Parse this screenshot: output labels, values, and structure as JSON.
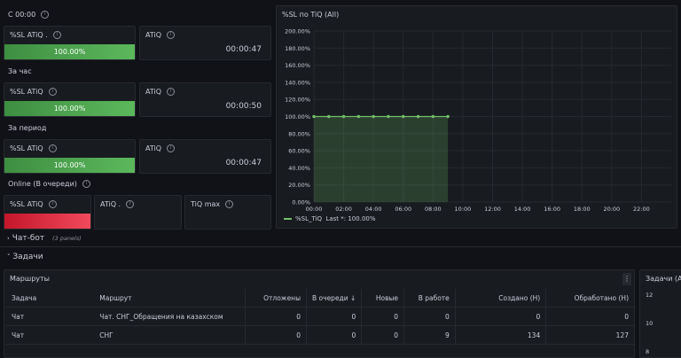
{
  "sections": {
    "since_midnight": "С 00:00",
    "per_hour": "За час",
    "per_period": "За период",
    "online": "Online (В очереди)"
  },
  "stats": {
    "since_midnight": {
      "sl_title": "%SL ATiQ .",
      "sl_value": "100.00%",
      "sl_fraction": 1.0,
      "atiq_title": "ATiQ",
      "atiq_value": "00:00:47"
    },
    "per_hour": {
      "sl_title": "%SL ATiQ",
      "sl_value": "100.00%",
      "sl_fraction": 1.0,
      "atiq_title": "ATiQ",
      "atiq_value": "00:00:50"
    },
    "per_period": {
      "sl_title": "%SL ATiQ",
      "sl_value": "100.00%",
      "sl_fraction": 1.0,
      "atiq_title": "ATiQ",
      "atiq_value": "00:00:47"
    },
    "online": {
      "sl_title": "%SL ATiQ",
      "atiq_title": "ATiQ .",
      "tiq_max_title": "TiQ max"
    }
  },
  "colors": {
    "ok": "#5cb85c",
    "bad": "#f2495c",
    "series": "#73bf69"
  },
  "chart_panel": {
    "title": "%SL по TiQ (All)"
  },
  "chart_data": {
    "type": "area",
    "title": "%SL по TiQ (All)",
    "x": [
      "00:00",
      "00:30",
      "01:00",
      "01:30",
      "02:00",
      "02:30",
      "03:00",
      "03:30",
      "04:00",
      "04:30",
      "05:00",
      "05:30",
      "06:00",
      "06:30",
      "07:00",
      "07:30",
      "08:00",
      "08:30",
      "09:00"
    ],
    "series": [
      {
        "name": "%SL_TiQ",
        "values": [
          100,
          100,
          100,
          100,
          100,
          100,
          100,
          100,
          100,
          100,
          100,
          100,
          100,
          100,
          100,
          100,
          100,
          100,
          100
        ]
      }
    ],
    "x_ticks": [
      "00:00",
      "02:00",
      "04:00",
      "06:00",
      "08:00",
      "10:00",
      "12:00",
      "14:00",
      "16:00",
      "18:00",
      "20:00",
      "22:00"
    ],
    "y_ticks": [
      "200.00%",
      "180.00%",
      "160.00%",
      "140.00%",
      "120.00%",
      "100.00%",
      "80.00%",
      "60.00%",
      "40.00%",
      "20.00%",
      "0.00%"
    ],
    "ylim": [
      0,
      200
    ],
    "xlim_hours": [
      0,
      24
    ],
    "marker_hours": [
      0,
      1,
      2,
      3,
      4,
      5,
      6,
      7,
      8,
      9
    ],
    "legend": {
      "name": "%SL_TiQ",
      "stat": "Last *: 100.00%"
    },
    "legend_position": "bottom-left",
    "grid": true
  },
  "rows": {
    "chatbot": {
      "title": "Чат-бот",
      "meta": "(3 panels)"
    },
    "tasks": {
      "title": "Задачи"
    }
  },
  "routes": {
    "title": "Маршруты",
    "columns": [
      "Задача",
      "Маршрут",
      "Отложены",
      "В очереди ↓",
      "Новые",
      "В работе",
      "Создано (Н)",
      "Обработано (Н)"
    ],
    "rows": [
      [
        "Чат",
        "Чат. СНГ_Обращения на казахском",
        "0",
        "0",
        "0",
        "0",
        "0",
        "0"
      ],
      [
        "Чат",
        "СНГ",
        "0",
        "0",
        "0",
        "9",
        "134",
        "127"
      ]
    ]
  },
  "right_panel": {
    "title": "Задачи (All",
    "y_ticks": [
      "12",
      "10",
      "8"
    ]
  }
}
